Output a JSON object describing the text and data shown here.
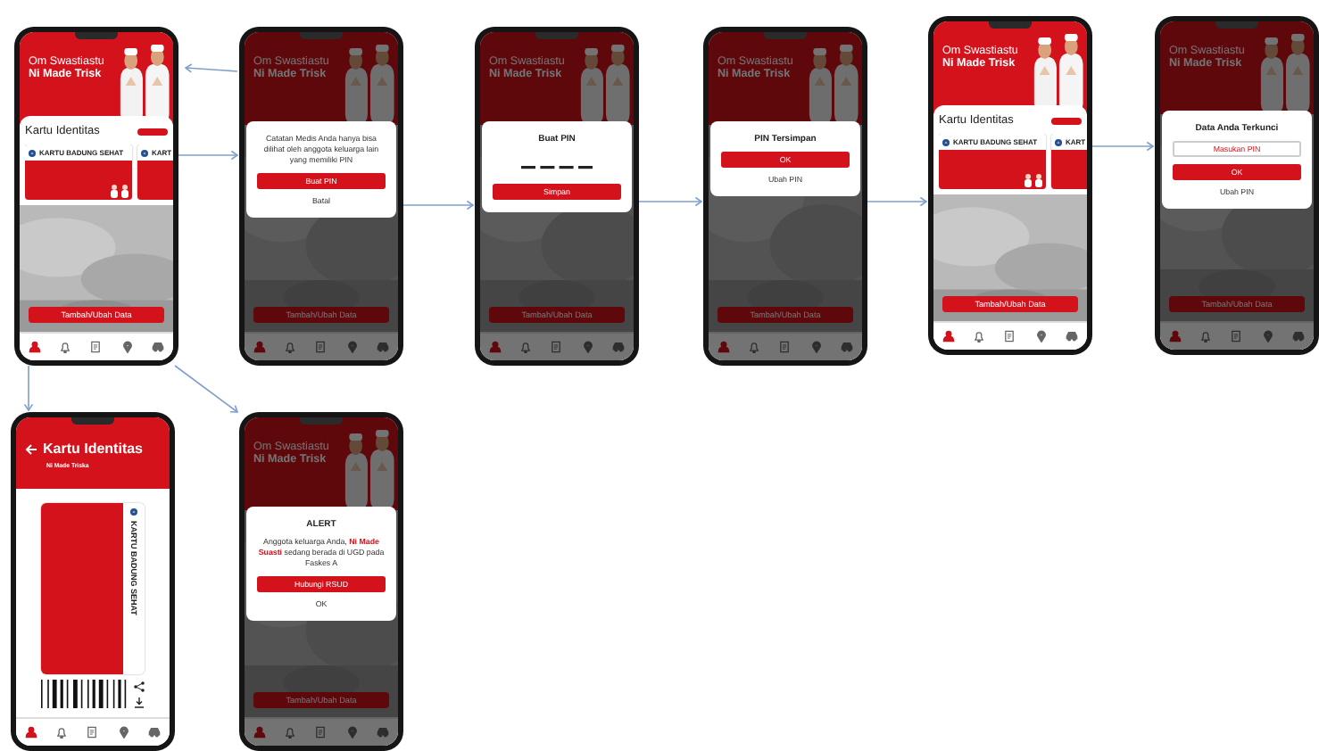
{
  "screens": [
    {
      "kind": "home",
      "header": {
        "greeting": "Om Swastiastu",
        "name": "Ni Made Trisk"
      },
      "section_title": "Kartu Identitas",
      "cards": [
        {
          "title": "KARTU BADUNG SEHAT"
        },
        {
          "title": "KART"
        }
      ],
      "action_button": "Tambah/Ubah Data",
      "nav": [
        {
          "selected": true
        },
        {
          "selected": false
        },
        {
          "selected": false
        },
        {
          "selected": false
        },
        {
          "selected": false
        }
      ]
    },
    {
      "kind": "dialog",
      "header": {
        "greeting": "Om Swastiastu",
        "name": "Ni Made Trisk"
      },
      "action_button": "Tambah/Ubah Data",
      "dialog": {
        "message": "Catatan Medis Anda hanya bisa dilihat oleh anggota keluarga lain yang memiliki PIN",
        "primary": "Buat PIN",
        "secondary": "Batal"
      },
      "nav": [
        {
          "selected": true
        },
        {
          "selected": false
        },
        {
          "selected": false
        },
        {
          "selected": false
        },
        {
          "selected": false
        }
      ]
    },
    {
      "kind": "dialog",
      "header": {
        "greeting": "Om Swastiastu",
        "name": "Ni Made Trisk"
      },
      "action_button": "Tambah/Ubah Data",
      "dialog": {
        "title": "Buat PIN",
        "pin_entry": true,
        "primary": "Simpan"
      },
      "nav": [
        {
          "selected": true
        },
        {
          "selected": false
        },
        {
          "selected": false
        },
        {
          "selected": false
        },
        {
          "selected": false
        }
      ]
    },
    {
      "kind": "dialog",
      "header": {
        "greeting": "Om Swastiastu",
        "name": "Ni Made Trisk"
      },
      "action_button": "Tambah/Ubah Data",
      "dialog": {
        "title": "PIN Tersimpan",
        "primary": "OK",
        "secondary": "Ubah PIN"
      },
      "nav": [
        {
          "selected": true
        },
        {
          "selected": false
        },
        {
          "selected": false
        },
        {
          "selected": false
        },
        {
          "selected": false
        }
      ]
    },
    {
      "kind": "home",
      "header": {
        "greeting": "Om Swastiastu",
        "name": "Ni Made Trisk"
      },
      "section_title": "Kartu Identitas",
      "cards": [
        {
          "title": "KARTU BADUNG SEHAT"
        },
        {
          "title": "KART"
        }
      ],
      "action_button": "Tambah/Ubah Data",
      "nav": [
        {
          "selected": true
        },
        {
          "selected": false
        },
        {
          "selected": false
        },
        {
          "selected": false
        },
        {
          "selected": false
        }
      ]
    },
    {
      "kind": "dialog",
      "header": {
        "greeting": "Om Swastiastu",
        "name": "Ni Made Trisk"
      },
      "action_button": "Tambah/Ubah Data",
      "dialog": {
        "title": "Data Anda Terkunci",
        "field": {
          "placeholder": "Masukan PIN"
        },
        "primary": "OK",
        "secondary": "Ubah PIN"
      },
      "nav": [
        {
          "selected": true
        },
        {
          "selected": false
        },
        {
          "selected": false
        },
        {
          "selected": false
        },
        {
          "selected": false
        }
      ]
    },
    {
      "kind": "card_detail",
      "title": "Kartu Identitas",
      "subtitle": "Ni Made Triska",
      "card_title": "KARTU BADUNG SEHAT",
      "nav": [
        {
          "selected": true
        },
        {
          "selected": false
        },
        {
          "selected": false
        },
        {
          "selected": false
        },
        {
          "selected": false
        }
      ]
    },
    {
      "kind": "dialog",
      "header": {
        "greeting": "Om Swastiastu",
        "name": "Ni Made Trisk"
      },
      "action_button": "Tambah/Ubah Data",
      "dialog": {
        "title": "ALERT",
        "message": "Anggota keluarga Anda, **Ni Made Suasti** sedang berada di UGD pada Faskes A",
        "primary": "Hubungi RSUD",
        "secondary": "OK"
      },
      "nav": [
        {
          "selected": true
        },
        {
          "selected": false
        },
        {
          "selected": false
        },
        {
          "selected": false
        },
        {
          "selected": false
        }
      ]
    }
  ]
}
